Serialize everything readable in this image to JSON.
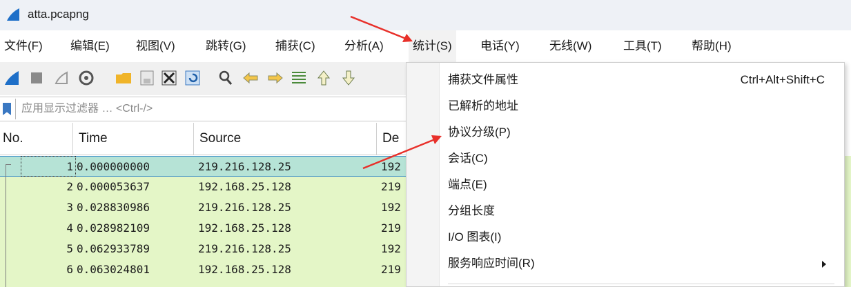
{
  "window": {
    "title": "atta.pcapng"
  },
  "menubar": {
    "items": [
      {
        "label": "文件(F)"
      },
      {
        "label": "编辑(E)"
      },
      {
        "label": "视图(V)"
      },
      {
        "label": "跳转(G)"
      },
      {
        "label": "捕获(C)"
      },
      {
        "label": "分析(A)"
      },
      {
        "label": "统计(S)"
      },
      {
        "label": "电话(Y)"
      },
      {
        "label": "无线(W)"
      },
      {
        "label": "工具(T)"
      },
      {
        "label": "帮助(H)"
      }
    ],
    "active": "统计(S)"
  },
  "toolbar": {
    "icons": [
      "start-capture-icon",
      "stop-capture-icon",
      "restart-capture-icon",
      "capture-options-icon",
      "open-file-icon",
      "save-file-icon",
      "close-file-icon",
      "reload-file-icon",
      "find-packet-icon",
      "go-back-icon",
      "go-forward-icon",
      "go-to-packet-icon",
      "go-first-icon",
      "go-last-icon"
    ]
  },
  "filter": {
    "placeholder": "应用显示过滤器 … <Ctrl-/>"
  },
  "packet_list": {
    "columns": [
      "No.",
      "Time",
      "Source",
      "De"
    ],
    "rows": [
      {
        "no": "1",
        "time": "0.000000000",
        "source": "219.216.128.25",
        "dest": "192"
      },
      {
        "no": "2",
        "time": "0.000053637",
        "source": "192.168.25.128",
        "dest": "219"
      },
      {
        "no": "3",
        "time": "0.028830986",
        "source": "219.216.128.25",
        "dest": "192"
      },
      {
        "no": "4",
        "time": "0.028982109",
        "source": "192.168.25.128",
        "dest": "219"
      },
      {
        "no": "5",
        "time": "0.062933789",
        "source": "219.216.128.25",
        "dest": "192"
      },
      {
        "no": "6",
        "time": "0.063024801",
        "source": "192.168.25.128",
        "dest": "219"
      }
    ],
    "selected_row": "1"
  },
  "statistics_menu": {
    "items": [
      {
        "label": "捕获文件属性",
        "shortcut": "Ctrl+Alt+Shift+C"
      },
      {
        "label": "已解析的地址"
      },
      {
        "label": "协议分级(P)"
      },
      {
        "label": "会话(C)"
      },
      {
        "label": "端点(E)"
      },
      {
        "label": "分组长度"
      },
      {
        "label": "I/O 图表(I)"
      },
      {
        "label": "服务响应时间(R)",
        "submenu": true
      }
    ]
  },
  "colors": {
    "titlebar": "#eef1f6",
    "row_bg": "#e4f6c7",
    "selected_row_bg": "#b6e3d6",
    "annotation_arrow": "#e8302a"
  }
}
